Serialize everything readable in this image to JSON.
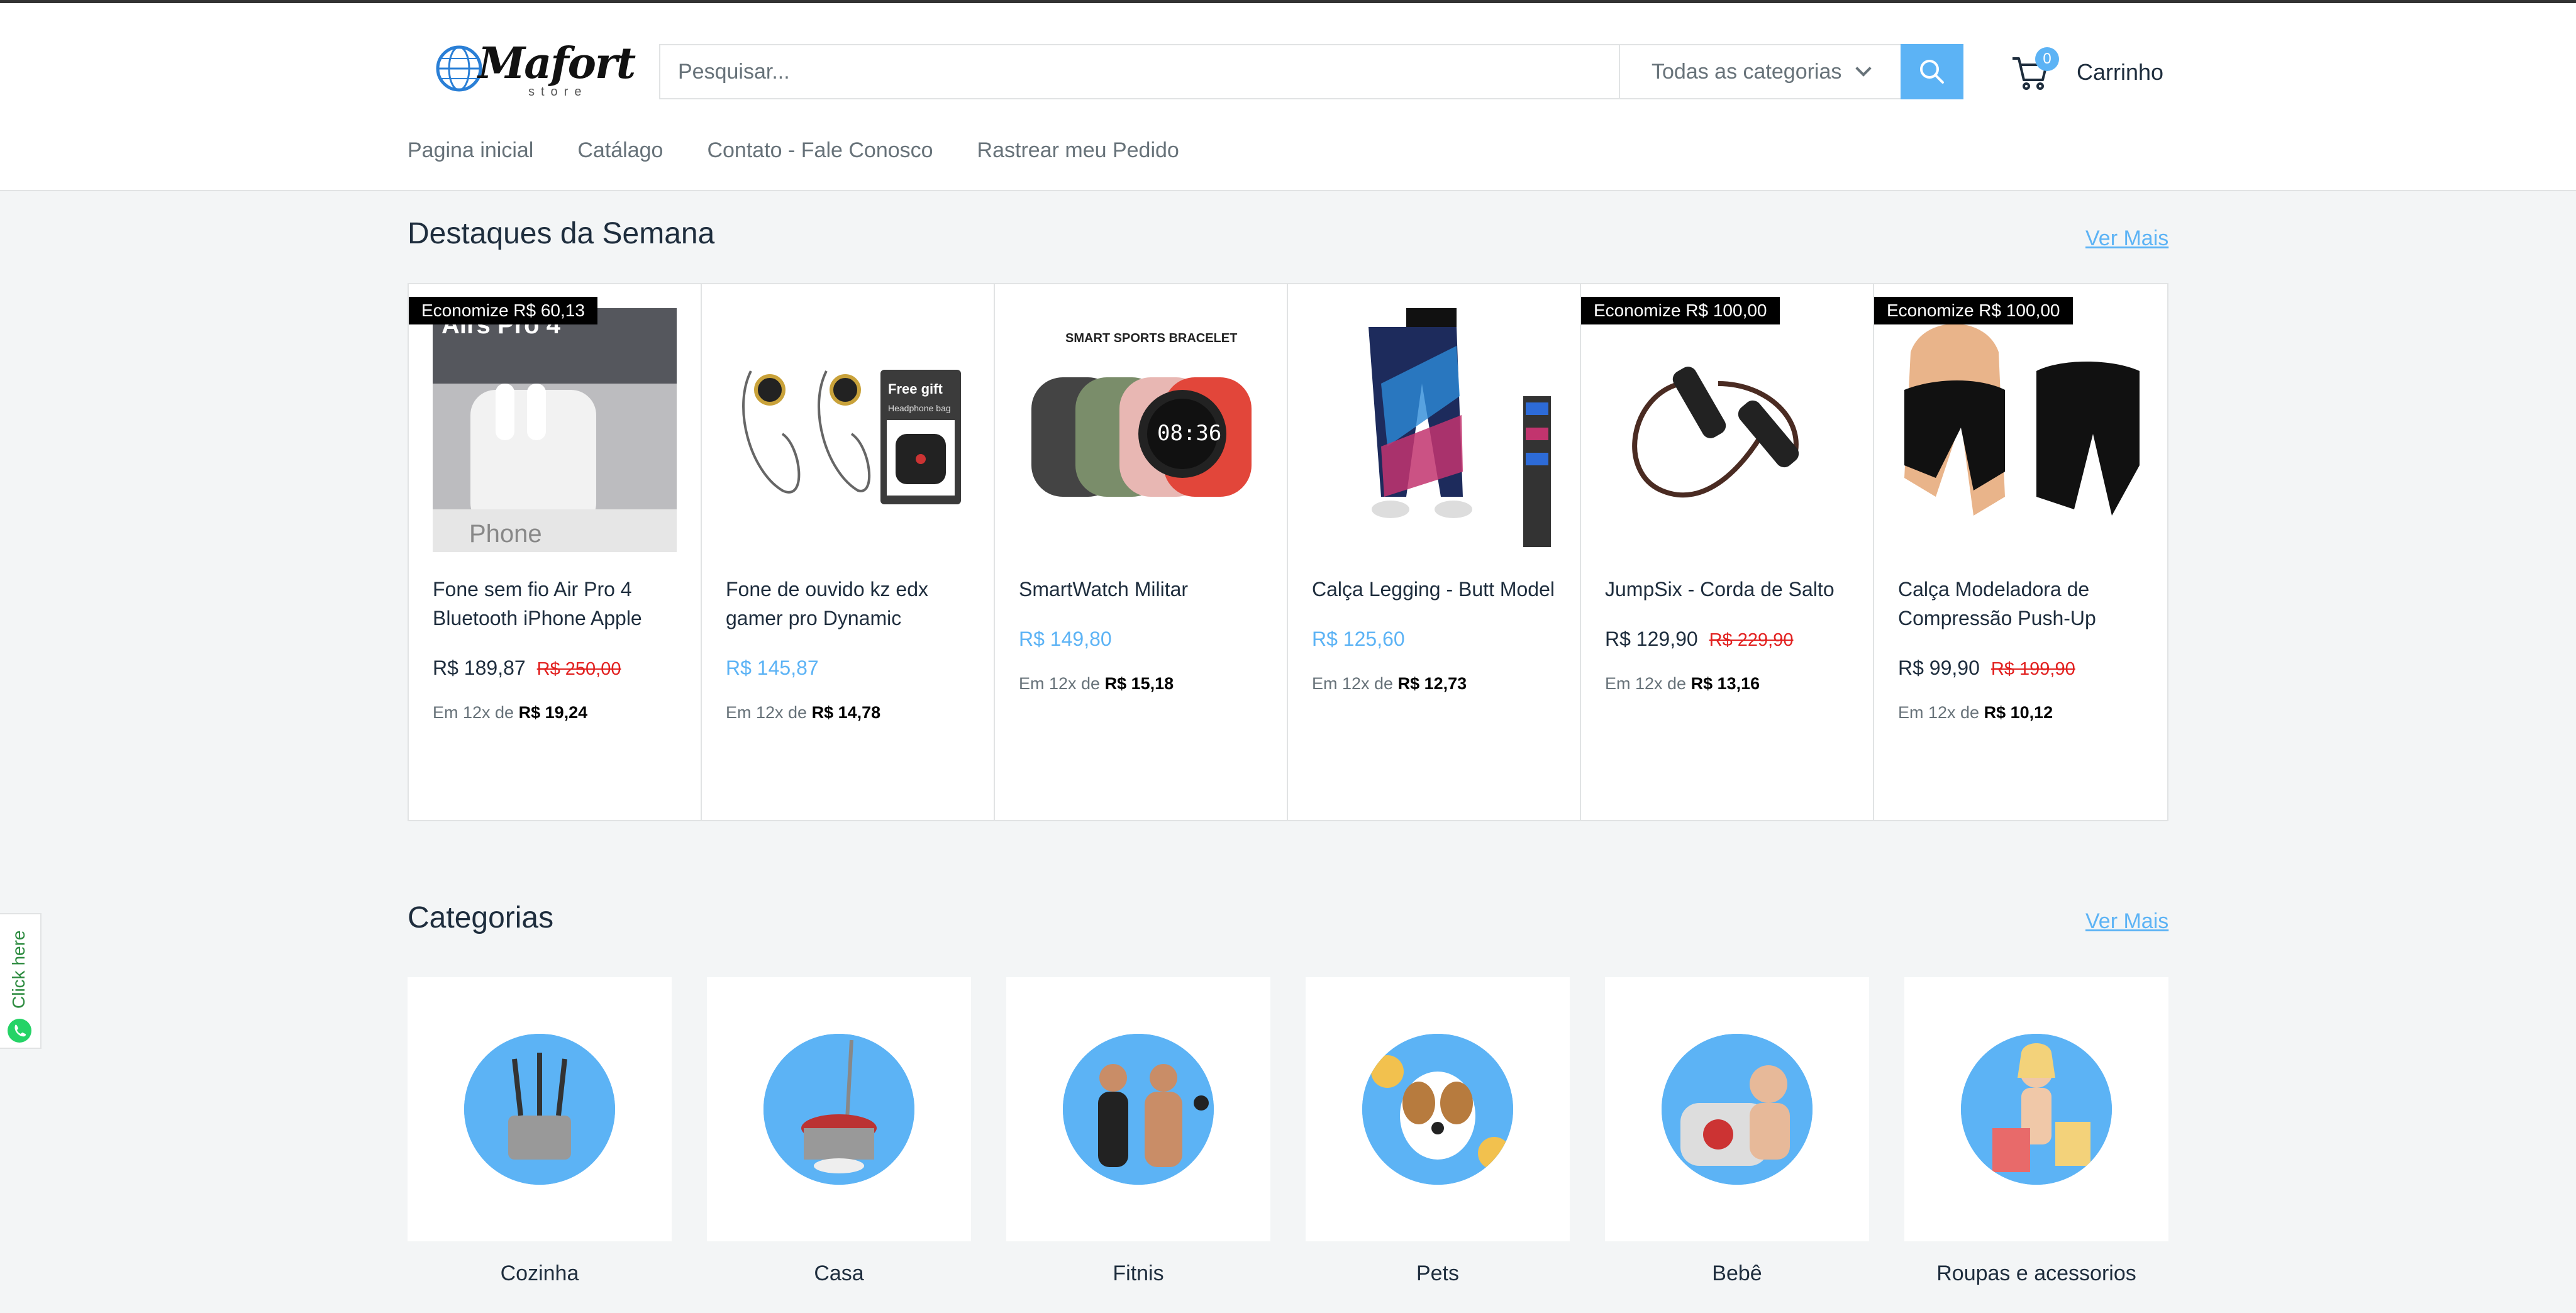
{
  "header": {
    "logo_text": "Mafort",
    "logo_sub": "store",
    "search_placeholder": "Pesquisar...",
    "category_select": "Todas as categorias",
    "cart_count": "0",
    "cart_label": "Carrinho"
  },
  "nav": [
    {
      "label": "Pagina inicial"
    },
    {
      "label": "Catálago"
    },
    {
      "label": "Contato - Fale Conosco"
    },
    {
      "label": "Rastrear meu Pedido"
    }
  ],
  "highlights": {
    "title": "Destaques da Semana",
    "more": "Ver Mais",
    "products": [
      {
        "badge": "Economize R$ 60,13",
        "title": "Fone sem fio Air Pro 4 Bluetooth iPhone Apple",
        "price": "R$ 189,87",
        "old_price": "R$ 250,00",
        "installment_prefix": "Em 12x de",
        "installment_value": "R$ 19,24"
      },
      {
        "badge": "",
        "title": "Fone de ouvido kz edx gamer pro Dynamic",
        "price": "R$ 145,87",
        "old_price": "",
        "installment_prefix": "Em 12x de",
        "installment_value": "R$ 14,78"
      },
      {
        "badge": "",
        "title": "SmartWatch Militar",
        "price": "R$ 149,80",
        "old_price": "",
        "installment_prefix": "Em 12x de",
        "installment_value": "R$ 15,18"
      },
      {
        "badge": "",
        "title": "Calça Legging - Butt Model",
        "price": "R$ 125,60",
        "old_price": "",
        "installment_prefix": "Em 12x de",
        "installment_value": "R$ 12,73"
      },
      {
        "badge": "Economize R$ 100,00",
        "title": "JumpSix - Corda de Salto",
        "price": "R$ 129,90",
        "old_price": "R$ 229,90",
        "installment_prefix": "Em 12x de",
        "installment_value": "R$ 13,16"
      },
      {
        "badge": "Economize R$ 100,00",
        "title": "Calça Modeladora de Compressão Push-Up",
        "price": "R$ 99,90",
        "old_price": "R$ 199,90",
        "installment_prefix": "Em 12x de",
        "installment_value": "R$ 10,12"
      }
    ]
  },
  "categories": {
    "title": "Categorias",
    "more": "Ver Mais",
    "items": [
      {
        "label": "Cozinha"
      },
      {
        "label": "Casa"
      },
      {
        "label": "Fitnis"
      },
      {
        "label": "Pets"
      },
      {
        "label": "Bebê"
      },
      {
        "label": "Roupas e acessorios"
      }
    ]
  },
  "whatsapp": {
    "label": "Click here"
  },
  "colors": {
    "accent": "#5cb3f5",
    "sale": "#e22120",
    "text": "#1e2d3d",
    "muted": "#677279"
  }
}
